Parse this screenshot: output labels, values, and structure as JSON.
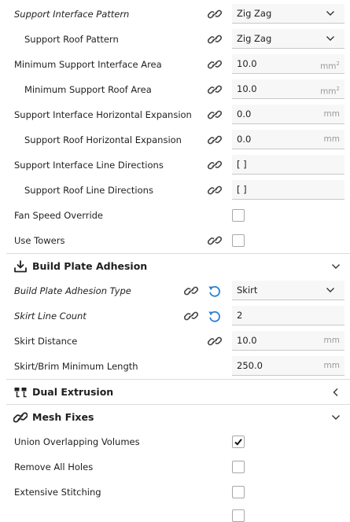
{
  "rows1": [
    {
      "label": "Support Interface Pattern",
      "value": "Zig Zag"
    },
    {
      "label": "Support Roof Pattern",
      "value": "Zig Zag"
    },
    {
      "label": "Minimum Support Interface Area",
      "value": "10.0",
      "unit": "mm"
    },
    {
      "label": "Minimum Support Roof Area",
      "value": "10.0",
      "unit": "mm"
    },
    {
      "label": "Support Interface Horizontal Expansion",
      "value": "0.0",
      "unit": "mm"
    },
    {
      "label": "Support Roof Horizontal Expansion",
      "value": "0.0",
      "unit": "mm"
    },
    {
      "label": "Support Interface Line Directions",
      "value": "[ ]"
    },
    {
      "label": "Support Roof Line Directions",
      "value": "[ ]"
    },
    {
      "label": "Fan Speed Override"
    },
    {
      "label": "Use Towers"
    }
  ],
  "section_adhesion": {
    "title": "Build Plate Adhesion"
  },
  "rows2": [
    {
      "label": "Build Plate Adhesion Type",
      "value": "Skirt"
    },
    {
      "label": "Skirt Line Count",
      "value": "2"
    },
    {
      "label": "Skirt Distance",
      "value": "10.0",
      "unit": "mm"
    },
    {
      "label": "Skirt/Brim Minimum Length",
      "value": "250.0",
      "unit": "mm"
    }
  ],
  "section_dual": {
    "title": "Dual Extrusion"
  },
  "section_mesh": {
    "title": "Mesh Fixes"
  },
  "rows3": [
    {
      "label": "Union Overlapping Volumes",
      "checked": true
    },
    {
      "label": "Remove All Holes",
      "checked": false
    },
    {
      "label": "Extensive Stitching",
      "checked": false
    }
  ]
}
